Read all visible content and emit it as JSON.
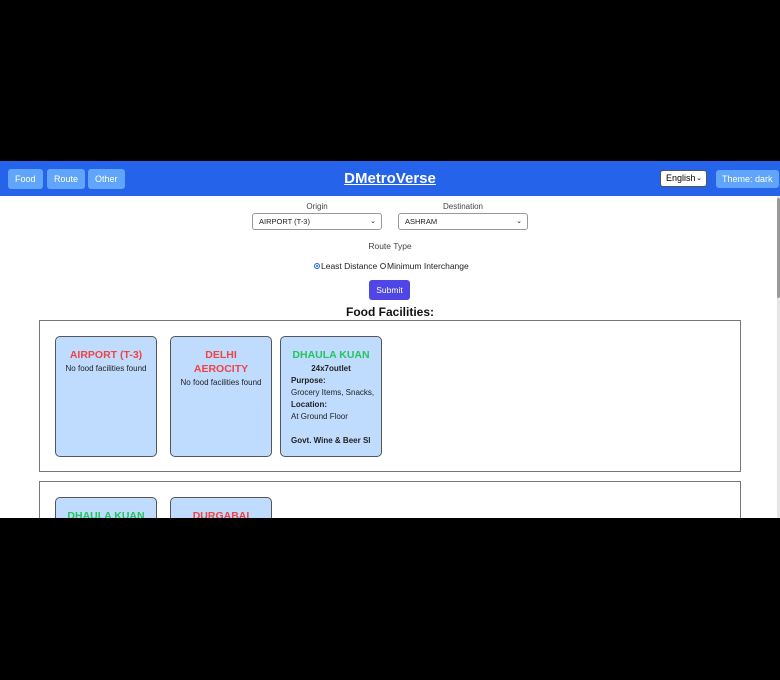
{
  "nav": {
    "buttons": [
      "Food",
      "Route",
      "Other"
    ],
    "brand": "DMetroVerse",
    "language": "English",
    "theme": "Theme: dark"
  },
  "form": {
    "origin_label": "Origin",
    "origin_value": "AIRPORT (T-3)",
    "destination_label": "Destination",
    "destination_value": "ASHRAM",
    "route_type_label": "Route Type",
    "option_least": "Least Distance",
    "option_min": "Minimum Interchange",
    "submit": "Submit"
  },
  "food": {
    "heading": "Food Facilities:",
    "row1": [
      {
        "station": "AIRPORT (T-3)",
        "message": "No food facilities found"
      },
      {
        "station": "DELHI AEROCITY",
        "message": "No food facilities found"
      },
      {
        "station": "DHAULA KUAN",
        "outlet": "24x7outlet",
        "purpose_label": "Purpose:",
        "purpose": "Grocery Items, Snacks,",
        "location_label": "Location:",
        "location": "At Ground Floor",
        "outlet2": "Govt. Wine & Beer Sl"
      }
    ],
    "row2": [
      {
        "station": "DHAULA KUAN"
      },
      {
        "station": "DURGABAI"
      }
    ]
  },
  "colors": {
    "nav": "#2563eb",
    "button": "#60a5fa",
    "submit": "#4f46e5",
    "card": "#bfdbfe",
    "no_food": "#ef4444",
    "has_food": "#22c55e"
  }
}
